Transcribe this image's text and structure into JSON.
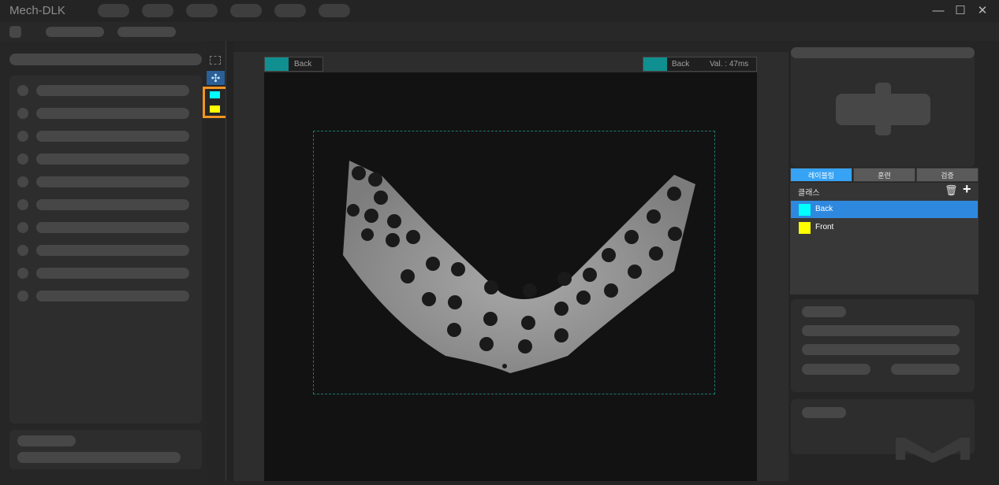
{
  "app": {
    "title": "Mech-DLK"
  },
  "window_controls": {
    "minimize": "—",
    "maximize": "☐",
    "close": "✕"
  },
  "canvas": {
    "left_tag": {
      "label": "Back",
      "color": "#0f8f8f"
    },
    "right_tag": {
      "label": "Back",
      "value_text": "Val. : 47ms",
      "color": "#0f8f8f"
    }
  },
  "toolstrip": {
    "move_icon": "✣",
    "swatches": [
      {
        "color": "#00ffff"
      },
      {
        "color": "#ffff00"
      }
    ]
  },
  "tabs": [
    {
      "label": "레이블링",
      "active": true
    },
    {
      "label": "훈련",
      "active": false
    },
    {
      "label": "검증",
      "active": false
    }
  ],
  "class_panel": {
    "title": "클래스",
    "delete_icon": "🗑",
    "add_icon": "+",
    "classes": [
      {
        "name": "Back",
        "color": "#00ffff",
        "selected": true
      },
      {
        "name": "Front",
        "color": "#ffff00",
        "selected": false
      }
    ]
  },
  "colors": {
    "accent": "#36a3f5",
    "highlight": "#f29422"
  }
}
